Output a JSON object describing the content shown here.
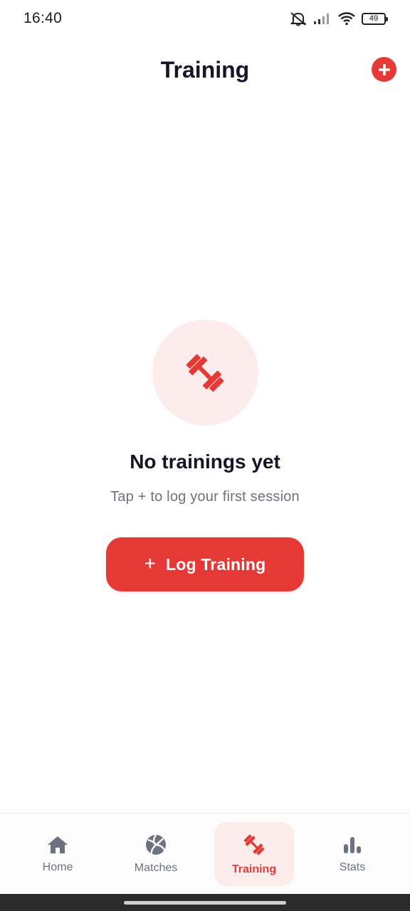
{
  "status_bar": {
    "time": "16:40",
    "battery": "49",
    "icons": [
      "mute-icon",
      "signal-icon",
      "wifi-icon",
      "battery-icon"
    ]
  },
  "header": {
    "title": "Training",
    "add_icon": "plus-circle-icon"
  },
  "empty_state": {
    "icon": "dumbbell-icon",
    "title": "No trainings yet",
    "subtitle": "Tap + to log your first session",
    "button_icon": "+",
    "button_label": "Log Training"
  },
  "bottom_nav": {
    "items": [
      {
        "label": "Home",
        "icon": "home-icon",
        "active": false
      },
      {
        "label": "Matches",
        "icon": "volleyball-icon",
        "active": false
      },
      {
        "label": "Training",
        "icon": "dumbbell-icon",
        "active": true
      },
      {
        "label": "Stats",
        "icon": "bar-chart-icon",
        "active": false
      }
    ]
  },
  "colors": {
    "accent": "#e53935",
    "accent_soft": "#fdecec",
    "text_primary": "#141526",
    "text_secondary": "#6b7280"
  }
}
